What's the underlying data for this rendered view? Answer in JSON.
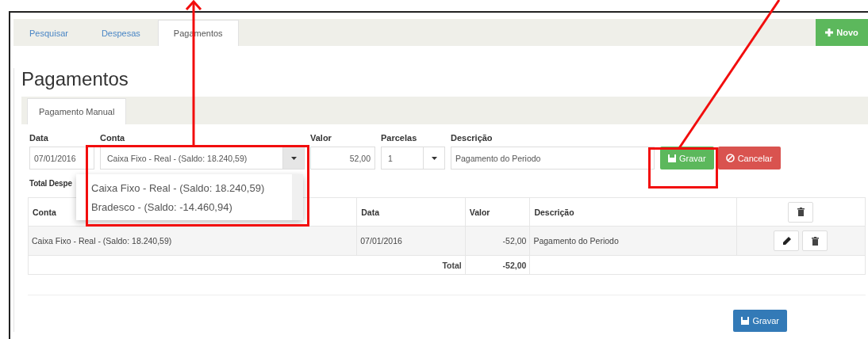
{
  "tabs": [
    {
      "label": "Pesquisar",
      "selected": false
    },
    {
      "label": "Despesas",
      "selected": false
    },
    {
      "label": "Pagamentos",
      "selected": true
    }
  ],
  "new_button": {
    "label": "Novo"
  },
  "title": "Pagamentos",
  "subtabs": [
    {
      "label": "Pagamento Manual",
      "selected": true
    }
  ],
  "form": {
    "fields": [
      {
        "kind": "text",
        "label": "Data",
        "value": "07/01/2016"
      },
      {
        "kind": "select",
        "label": "Conta",
        "value": "Caixa Fixo - Real - (Saldo: 18.240,59)"
      },
      {
        "kind": "number",
        "label": "Valor",
        "value": "52,00"
      },
      {
        "kind": "select",
        "label": "Parcelas",
        "value": "1"
      },
      {
        "kind": "text",
        "label": "Descrição",
        "value": "Pagamento do Periodo"
      }
    ],
    "buttons": [
      {
        "kind": "save",
        "label": "Gravar"
      },
      {
        "kind": "cancel",
        "label": "Cancelar"
      }
    ]
  },
  "dropdown": {
    "options": [
      "Caixa Fixo - Real - (Saldo: 18.240,59)",
      "Bradesco - (Saldo: -14.460,94)"
    ]
  },
  "total_label": "Total Despe",
  "table": {
    "columns": [
      "Conta",
      "Data",
      "Valor",
      "Descrição"
    ],
    "rows": [
      {
        "cells": [
          "Caixa Fixo - Real - (Saldo: 18.240,59)",
          "07/01/2016",
          "-52,00",
          "Pagamento do Periodo"
        ]
      }
    ],
    "total": {
      "label": "Total",
      "value": "-52,00"
    }
  },
  "footer_button": {
    "label": "Gravar"
  }
}
